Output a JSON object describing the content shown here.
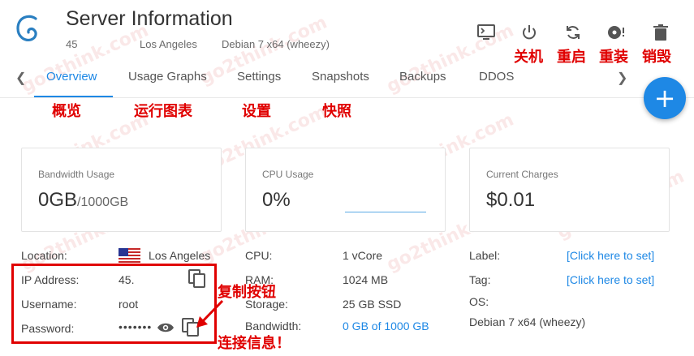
{
  "header": {
    "title": "Server Information",
    "server_id": "45",
    "location": "Los Angeles",
    "os": "Debian 7 x64 (wheezy)"
  },
  "toolbar": {
    "console_icon": "console-icon",
    "power_icon": "power-icon",
    "restart_icon": "restart-icon",
    "reinstall_icon": "reinstall-icon",
    "delete_icon": "trash-icon"
  },
  "annotations": {
    "power": "关机",
    "restart": "重启",
    "reinstall": "重装",
    "destroy": "销毁",
    "overview": "概览",
    "graphs": "运行图表",
    "settings": "设置",
    "snapshots": "快照",
    "copy_button": "复制按钮",
    "connect_info": "连接信息！"
  },
  "tabs": [
    {
      "label": "Overview"
    },
    {
      "label": "Usage Graphs"
    },
    {
      "label": "Settings"
    },
    {
      "label": "Snapshots"
    },
    {
      "label": "Backups"
    },
    {
      "label": "DDOS"
    }
  ],
  "cards": {
    "bandwidth": {
      "caption": "Bandwidth Usage",
      "value": "0GB",
      "total": "/1000GB"
    },
    "cpu": {
      "caption": "CPU Usage",
      "value": "0%"
    },
    "charges": {
      "caption": "Current Charges",
      "value": "$0.01"
    }
  },
  "details": {
    "location_label": "Location:",
    "location_value": "Los Angeles",
    "ip_label": "IP Address:",
    "ip_value": "45.",
    "username_label": "Username:",
    "username_value": "root",
    "password_label": "Password:",
    "password_value": "•••••••",
    "cpu_label": "CPU:",
    "cpu_value": "1 vCore",
    "ram_label": "RAM:",
    "ram_value": "1024 MB",
    "storage_label": "Storage:",
    "storage_value": "25 GB SSD",
    "bandwidth_label": "Bandwidth:",
    "bandwidth_value": "0 GB of 1000 GB",
    "label_label": "Label:",
    "label_value": "[Click here to set]",
    "tag_label": "Tag:",
    "tag_value": "[Click here to set]",
    "os_label": "OS:",
    "os_value": "Debian 7 x64 (wheezy)"
  },
  "watermark": "go2think.com",
  "colors": {
    "accent": "#1e88e5",
    "annotation": "#e00000"
  }
}
